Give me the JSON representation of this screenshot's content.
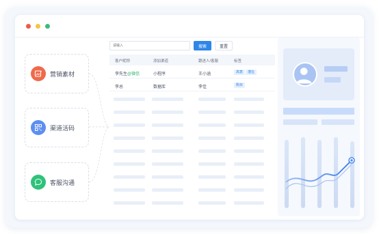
{
  "window": {
    "controls": [
      "close",
      "minimize",
      "maximize"
    ]
  },
  "channels": [
    {
      "label": "营销素材",
      "icon": "image-sparkle-icon",
      "color": "#ef6a4c"
    },
    {
      "label": "渠道活码",
      "icon": "qr-code-icon",
      "color": "#5d8ff0"
    },
    {
      "label": "客服沟通",
      "icon": "chat-bubble-icon",
      "color": "#2fc27a"
    }
  ],
  "toolbar": {
    "search_placeholder": "请输入",
    "search_label": "搜索",
    "reset_label": "重置"
  },
  "table": {
    "columns": [
      "客户昵称",
      "添加渠道",
      "跟进人/客服",
      "标签"
    ],
    "rows": [
      {
        "nickname": "李先生",
        "nickname_suffix": "@微信",
        "channel": "小程序",
        "owner": "王小涵",
        "tags": [
          "高意",
          "潜在"
        ]
      },
      {
        "nickname": "李总",
        "nickname_suffix": "",
        "channel": "数据库",
        "owner": "李佳",
        "tags": [
          "购买"
        ]
      }
    ]
  },
  "colors": {
    "primary": "#2f86e8",
    "accent_green": "#2fb06c",
    "chart_line": "#4f8ff0"
  }
}
